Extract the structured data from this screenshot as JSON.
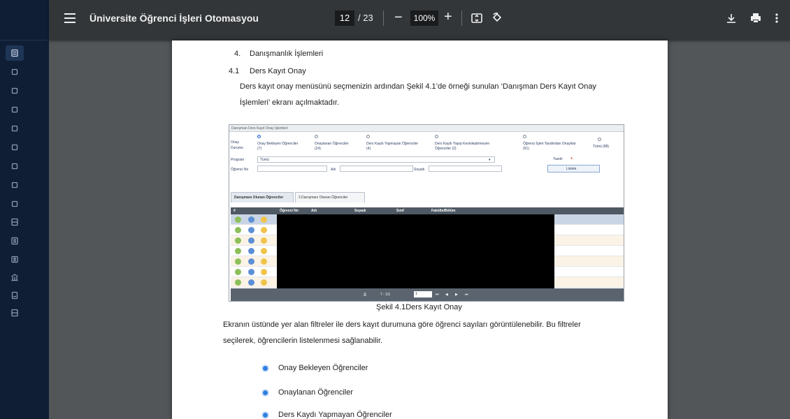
{
  "viewer": {
    "title": "Üniversite Öğrenci İşleri Otomasyou",
    "page_current": "12",
    "page_total": "/ 23",
    "zoom": "100%"
  },
  "document": {
    "section_4_num": "4.",
    "section_4_title": "Danışmanlık İşlemleri",
    "section_41_num": "4.1",
    "section_41_title": "Ders Kayıt Onay",
    "para1_line1": "Ders kayıt onay menüsünü seçmenizin ardından Şekil 4.1’de örneği sunulan ‘Danışman Ders Kayıt Onay",
    "para1_line2": "İşlemleri’ ekranı açılmaktadır.",
    "figure_caption": "Şekil 4.1Ders Kayıt Onay",
    "para2_line1": "Ekranın üstünde yer alan filtreler ile ders kayıt durumuna göre öğrenci sayıları görüntülenebilir. Bu filtreler",
    "para2_line2": "seçilerek, öğrencilerin listelenmesi sağlanabilir.",
    "bullets": [
      "Onay Bekleyen Öğrenciler",
      "Onaylanan Öğrenciler",
      "Ders Kaydı Yapmayan Öğrenciler"
    ]
  },
  "screenshot": {
    "header": "Danışman Ders Kayıt Onay İşlemleri",
    "onay_label_1": "Onay",
    "onay_label_2": "Durumu",
    "radios": [
      {
        "l1": "Onay Bekleyen Öğrenciler",
        "l2": "(7)"
      },
      {
        "l1": "Onaylanan Öğrenciler",
        "l2": "(24)"
      },
      {
        "l1": "Ders Kaydı Yapmayan Öğrenciler",
        "l2": "(4)"
      },
      {
        "l1": "Ders Kaydı Yapıp Kesinleştirmeyen",
        "l2": "Öğrenciler (2)"
      },
      {
        "l1": "Öğrenci İşleri Tarafından Onaylılar",
        "l2": "(91)"
      },
      {
        "l1": "Tümü (88)",
        "l2": ""
      }
    ],
    "program_label": "Program",
    "program_value": "Tümü",
    "ogrenci_no_label": "Öğrenci No",
    "adi_label": "Adı",
    "soyadi_label": "Soyadı",
    "yazdir_label": "Yazdır",
    "listele_label": "Listele",
    "tab1": "Danışmanı Olunan Öğrenciler",
    "tab2": "2.Danışmanı Olunan Öğrenciler",
    "columns": [
      "#",
      "Öğrenci No",
      "Adı",
      "Soyadı",
      "Sınıf",
      "Fakülte/Bölüm"
    ],
    "pager_range": "7 - 1/1",
    "pager_page": "1"
  }
}
